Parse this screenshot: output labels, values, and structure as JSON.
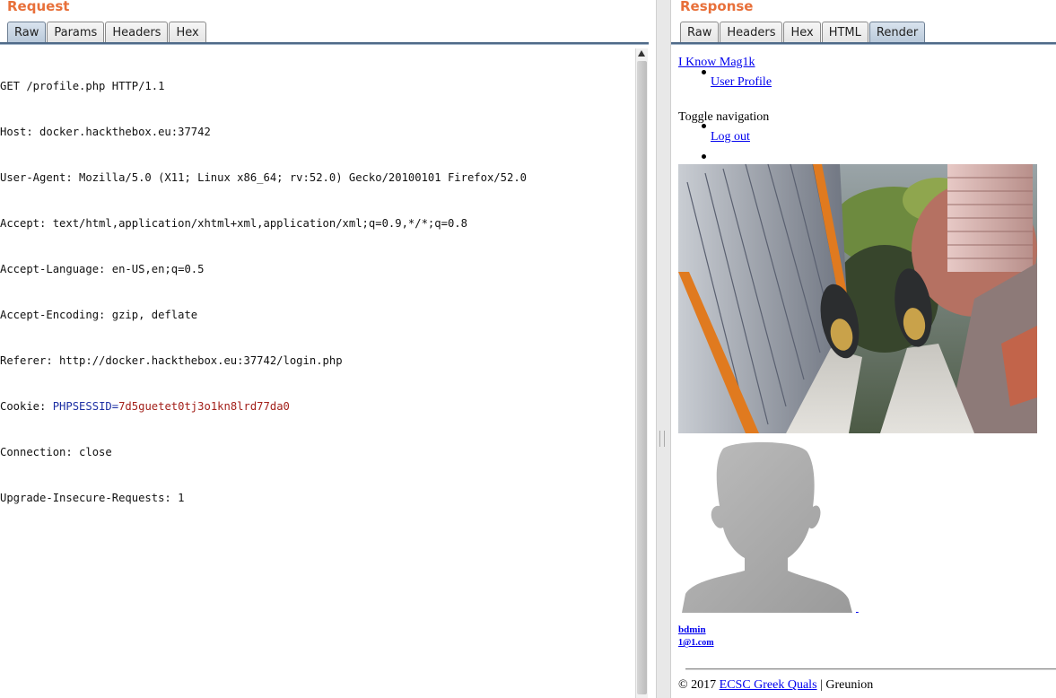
{
  "request": {
    "title": "Request",
    "tabs": [
      "Raw",
      "Params",
      "Headers",
      "Hex"
    ],
    "active_tab": "Raw",
    "lines": [
      "GET /profile.php HTTP/1.1",
      "Host: docker.hackthebox.eu:37742",
      "User-Agent: Mozilla/5.0 (X11; Linux x86_64; rv:52.0) Gecko/20100101 Firefox/52.0",
      "Accept: text/html,application/xhtml+xml,application/xml;q=0.9,*/*;q=0.8",
      "Accept-Language: en-US,en;q=0.5",
      "Accept-Encoding: gzip, deflate",
      "Referer: http://docker.hackthebox.eu:37742/login.php"
    ],
    "cookie": {
      "prefix": "Cookie: ",
      "name": "PHPSESSID",
      "eq": "=",
      "value": "7d5guetet0tj3o1kn8lrd77da0"
    },
    "lines_after": [
      "Connection: close",
      "Upgrade-Insecure-Requests: 1"
    ]
  },
  "response": {
    "title": "Response",
    "tabs": [
      "Raw",
      "Headers",
      "Hex",
      "HTML",
      "Render"
    ],
    "active_tab": "Render",
    "render": {
      "brand_link": "I Know Mag1k",
      "user_profile_link": "User Profile",
      "toggle_text": "Toggle navigation",
      "logout_link": "Log out",
      "username": "bdmin",
      "email": "1@1.com",
      "footer_prefix": "© 2017 ",
      "footer_link": "ECSC Greek Quals",
      "footer_suffix": " | Greunion"
    }
  },
  "colors": {
    "title_orange": "#e8703a",
    "link_blue": "#0000ee",
    "cookie_name": "#1d2fa3",
    "cookie_value": "#a3201a"
  }
}
